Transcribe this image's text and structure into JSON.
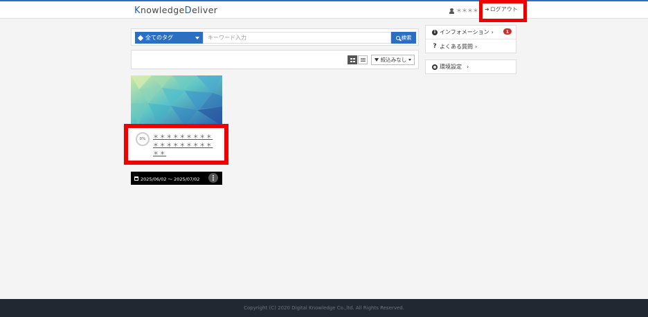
{
  "header": {
    "logo_k": "K",
    "logo_mid": "nowledge",
    "logo_d": "D",
    "logo_end": "eliver",
    "user_name": "＊＊＊＊",
    "logout_label": "ログアウト"
  },
  "search": {
    "tag_label": "全てのタグ",
    "keyword_placeholder": "キーワード入力",
    "search_label": "検索"
  },
  "toolbar": {
    "filter_label": "絞込みなし"
  },
  "course_card": {
    "progress": "0%",
    "title": "＊＊＊＊＊＊＊＊＊＊＊＊＊＊＊＊＊＊＊＊",
    "period": "2025/06/02 ～ 2025/07/02"
  },
  "sidebar": {
    "info_label": "インフォメーション",
    "info_badge": "1",
    "faq_label": "よくある質問",
    "settings_label": "環境設定"
  },
  "footer": {
    "copyright": "Copyright (C) 2020 Digital Knowledge Co.,ltd. All Rights Reserved."
  },
  "colors": {
    "accent": "#2a6fc1",
    "highlight": "#ee0000",
    "badge": "#c9302c",
    "footer_bg": "#222831"
  }
}
